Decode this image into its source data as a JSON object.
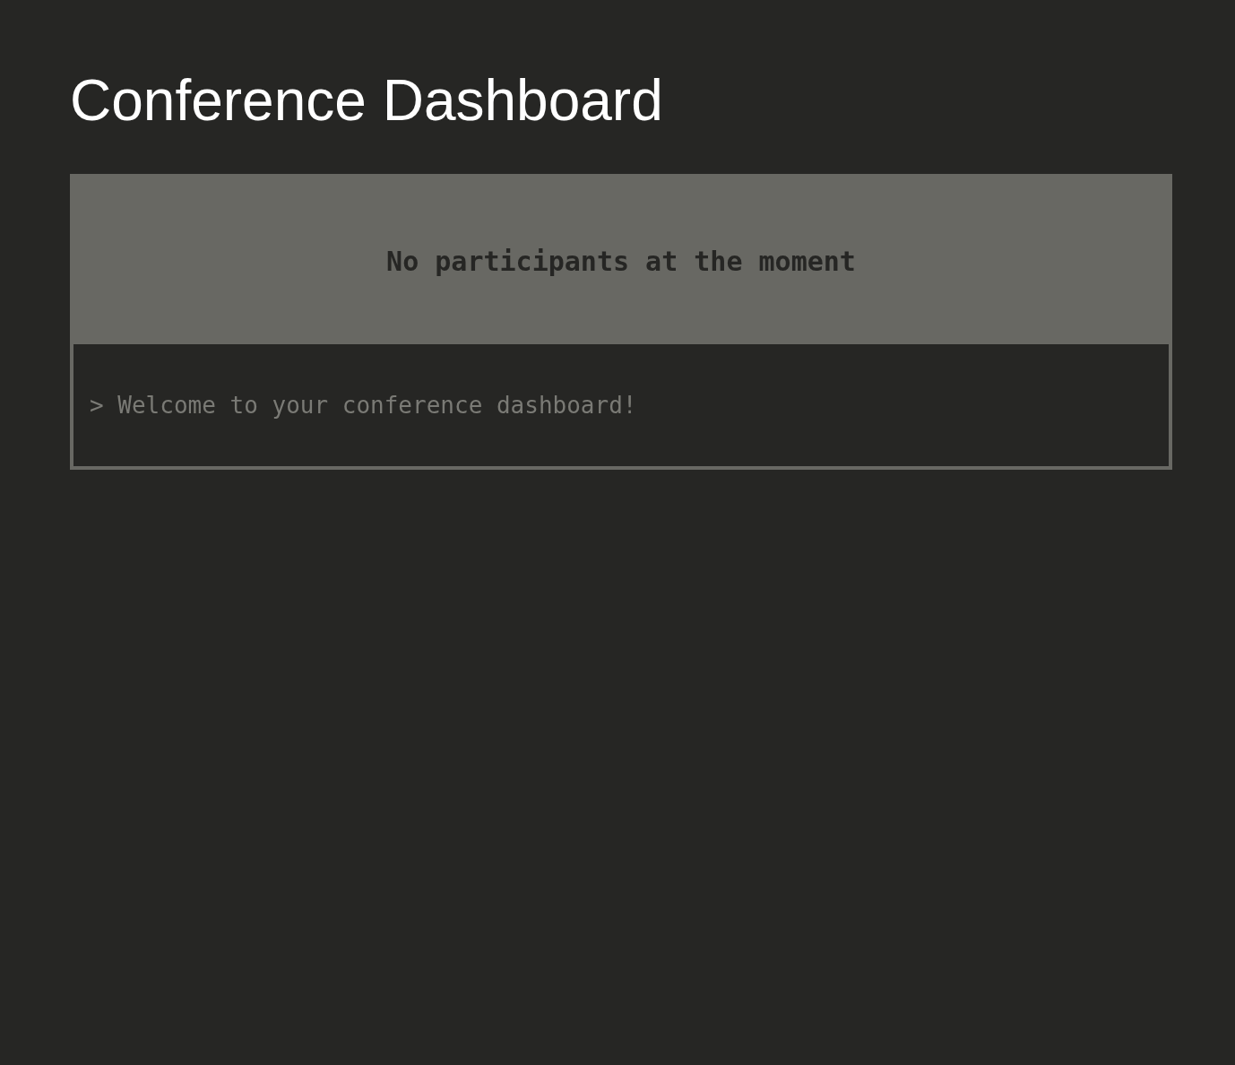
{
  "title": "Conference Dashboard",
  "participants_panel": {
    "empty_message": "No participants at the moment"
  },
  "console": {
    "lines": [
      "> Welcome to your conference dashboard!"
    ]
  }
}
